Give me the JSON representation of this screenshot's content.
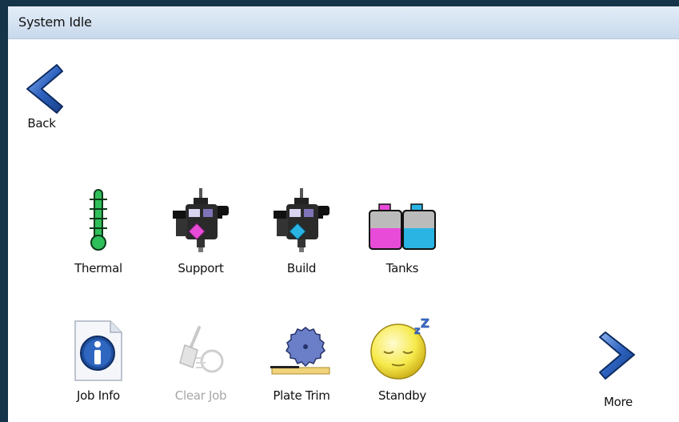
{
  "window": {
    "title": "System Idle"
  },
  "nav": {
    "back_label": "Back",
    "more_label": "More"
  },
  "tools": {
    "thermal": {
      "label": "Thermal",
      "icon": "thermometer-icon"
    },
    "support": {
      "label": "Support",
      "icon": "print-head-magenta-icon"
    },
    "build": {
      "label": "Build",
      "icon": "print-head-cyan-icon"
    },
    "tanks": {
      "label": "Tanks",
      "icon": "ink-tanks-icon"
    },
    "job_info": {
      "label": "Job Info",
      "icon": "info-document-icon"
    },
    "clear_job": {
      "label": "Clear Job",
      "icon": "broom-icon",
      "enabled": false
    },
    "plate_trim": {
      "label": "Plate Trim",
      "icon": "saw-blade-icon"
    },
    "standby": {
      "label": "Standby",
      "icon": "sleeping-face-icon"
    }
  },
  "colors": {
    "accent_blue": "#1f4f9c",
    "magenta": "#e84bd8",
    "cyan": "#2ab4e4",
    "thermal_green": "#2fbf5a",
    "frame": "#153349"
  }
}
